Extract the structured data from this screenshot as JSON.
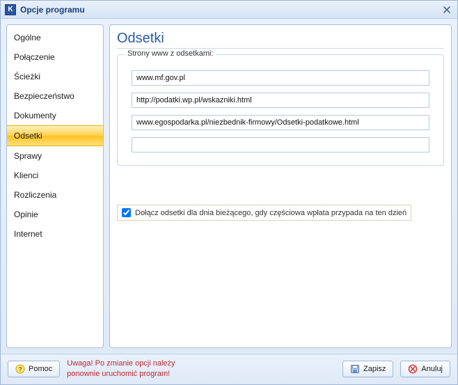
{
  "window": {
    "title": "Opcje programu"
  },
  "sidebar": {
    "items": [
      {
        "label": "Ogólne",
        "name": "sidebar-item-ogolne",
        "active": false
      },
      {
        "label": "Połączenie",
        "name": "sidebar-item-polaczenie",
        "active": false
      },
      {
        "label": "Ścieżki",
        "name": "sidebar-item-sciezki",
        "active": false
      },
      {
        "label": "Bezpieczeństwo",
        "name": "sidebar-item-bezpieczenstwo",
        "active": false
      },
      {
        "label": "Dokumenty",
        "name": "sidebar-item-dokumenty",
        "active": false
      },
      {
        "label": "Odsetki",
        "name": "sidebar-item-odsetki",
        "active": true
      },
      {
        "label": "Sprawy",
        "name": "sidebar-item-sprawy",
        "active": false
      },
      {
        "label": "Klienci",
        "name": "sidebar-item-klienci",
        "active": false
      },
      {
        "label": "Rozliczenia",
        "name": "sidebar-item-rozliczenia",
        "active": false
      },
      {
        "label": "Opinie",
        "name": "sidebar-item-opinie",
        "active": false
      },
      {
        "label": "Internet",
        "name": "sidebar-item-internet",
        "active": false
      }
    ]
  },
  "content": {
    "heading": "Odsetki",
    "group_label": "Strony www z odsetkami:",
    "urls": [
      "www.mf.gov.pl",
      "http://podatki.wp.pl/wskazniki.html",
      "www.egospodarka.pl/niezbednik-firmowy/Odsetki-podatkowe.html",
      ""
    ],
    "checkbox": {
      "checked": true,
      "label": "Dołącz odsetki dla dnia bieżącego, gdy częściowa wpłata przypada na ten dzień"
    }
  },
  "footer": {
    "help_label": "Pomoc",
    "warning": "Uwaga! Po zmianie opcji należy\nponownie uruchomić program!",
    "save_label": "Zapisz",
    "cancel_label": "Anuluj"
  }
}
